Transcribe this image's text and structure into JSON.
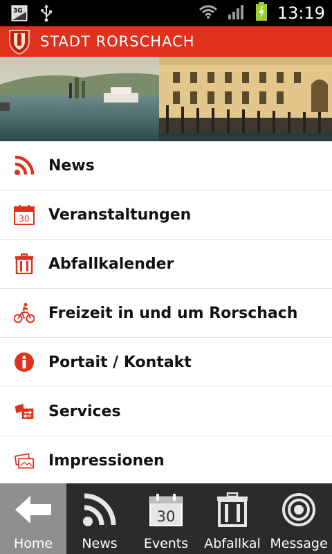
{
  "status_bar": {
    "network_type": "3G",
    "time": "13:19",
    "icons": [
      "network-3g-icon",
      "usb-icon",
      "wifi-icon",
      "signal-icon",
      "battery-charging-icon"
    ]
  },
  "header": {
    "brand": "STADT RORSCHACH",
    "accent_color": "#e0301e"
  },
  "menu": {
    "items": [
      {
        "label": "News",
        "icon": "rss-icon"
      },
      {
        "label": "Veranstaltungen",
        "icon": "calendar-icon",
        "icon_text": "30"
      },
      {
        "label": "Abfallkalender",
        "icon": "trash-bin-icon"
      },
      {
        "label": "Freizeit in und um Rorschach",
        "icon": "cyclist-icon"
      },
      {
        "label": "Portait / Kontakt",
        "icon": "info-icon"
      },
      {
        "label": "Services",
        "icon": "services-icon"
      },
      {
        "label": "Impressionen",
        "icon": "photos-icon"
      }
    ]
  },
  "tabbar": {
    "tabs": [
      {
        "label": "Home",
        "icon": "back-arrow-icon",
        "active": true
      },
      {
        "label": "News",
        "icon": "rss-icon",
        "active": false
      },
      {
        "label": "Events",
        "icon": "calendar-icon",
        "icon_text": "30",
        "active": false
      },
      {
        "label": "Abfallkal",
        "icon": "trash-bin-icon",
        "active": false
      },
      {
        "label": "Message",
        "icon": "target-icon",
        "active": false
      }
    ]
  }
}
